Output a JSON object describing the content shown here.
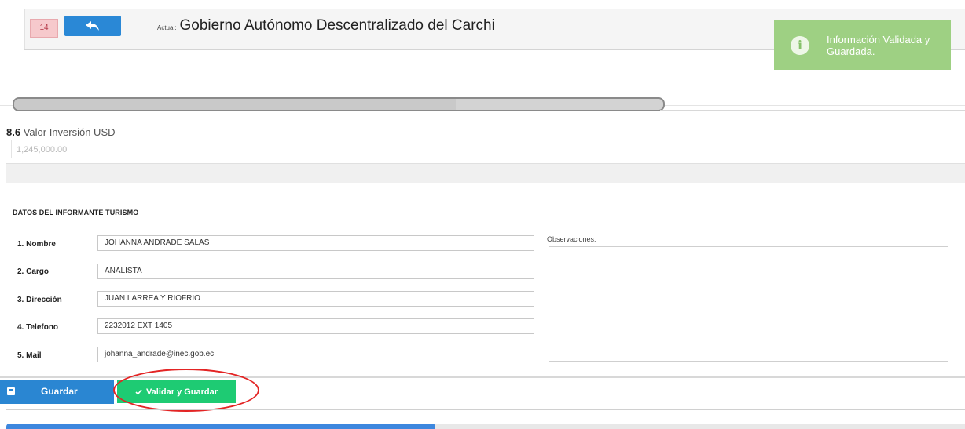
{
  "header": {
    "page_number": "14",
    "entity_prefix": "Actual:",
    "entity_name": "Gobierno Autónomo Descentralizado del Carchi"
  },
  "toast": {
    "message": "Información Validada y Guardada.",
    "icon": "info-icon",
    "color": "#9ed083"
  },
  "progress": {
    "value": 0.68
  },
  "investment": {
    "number": "8.6",
    "label": "Valor Inversión USD",
    "value": "1,245,000.00"
  },
  "informant": {
    "section_title": "DATOS DEL INFORMANTE TURISMO",
    "fields": [
      {
        "label": "1. Nombre",
        "value": "JOHANNA ANDRADE SALAS"
      },
      {
        "label": "2. Cargo",
        "value": "ANALISTA"
      },
      {
        "label": "3. Dirección",
        "value": "JUAN LARREA Y RIOFRIO"
      },
      {
        "label": "4. Telefono",
        "value": "2232012 EXT 1405"
      },
      {
        "label": "5. Mail",
        "value": "johanna_andrade@inec.gob.ec"
      }
    ],
    "observations_label": "Observaciones:",
    "observations_value": ""
  },
  "actions": {
    "save_label": "Guardar",
    "validate_label": "Validar y Guardar",
    "save_color": "#2a86d2",
    "validate_color": "#1ecb73",
    "highlight_color": "#e32424"
  }
}
